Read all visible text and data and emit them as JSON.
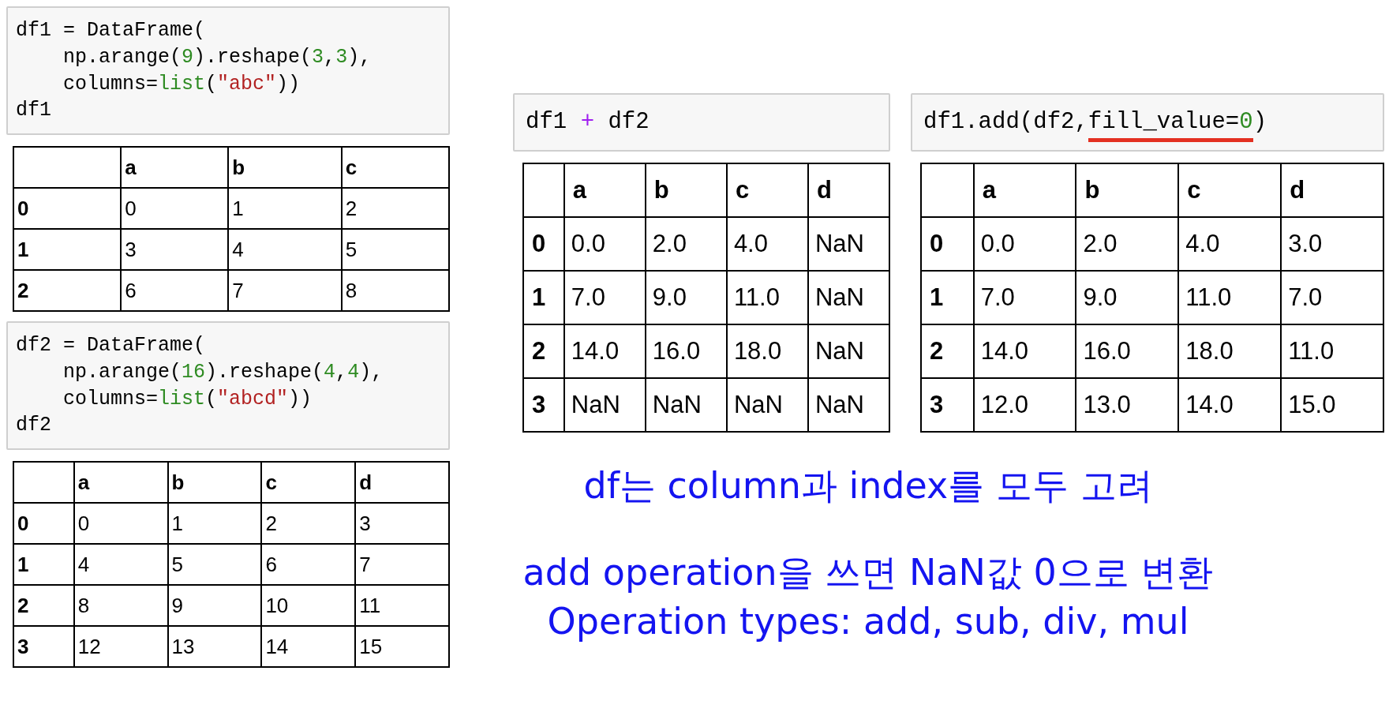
{
  "cells": [
    {
      "code": [
        [
          {
            "kind": "plain",
            "text": "df1 = DataFrame("
          }
        ],
        [
          {
            "kind": "plain",
            "text": "    np.arange("
          },
          {
            "kind": "number",
            "text": "9"
          },
          {
            "kind": "plain",
            "text": ").reshape("
          },
          {
            "kind": "number",
            "text": "3"
          },
          {
            "kind": "plain",
            "text": ","
          },
          {
            "kind": "number",
            "text": "3"
          },
          {
            "kind": "plain",
            "text": "),"
          }
        ],
        [
          {
            "kind": "plain",
            "text": "    columns="
          },
          {
            "kind": "builtin",
            "text": "list"
          },
          {
            "kind": "plain",
            "text": "("
          },
          {
            "kind": "string",
            "text": "\"abc\""
          },
          {
            "kind": "plain",
            "text": "))"
          }
        ],
        [
          {
            "kind": "plain",
            "text": "df1"
          }
        ]
      ],
      "table": {
        "columns": [
          "a",
          "b",
          "c"
        ],
        "rows": [
          {
            "index": "0",
            "values": [
              "0",
              "1",
              "2"
            ]
          },
          {
            "index": "1",
            "values": [
              "3",
              "4",
              "5"
            ]
          },
          {
            "index": "2",
            "values": [
              "6",
              "7",
              "8"
            ]
          }
        ]
      }
    },
    {
      "code": [
        [
          {
            "kind": "plain",
            "text": "df2 = DataFrame("
          }
        ],
        [
          {
            "kind": "plain",
            "text": "    np.arange("
          },
          {
            "kind": "number",
            "text": "16"
          },
          {
            "kind": "plain",
            "text": ").reshape("
          },
          {
            "kind": "number",
            "text": "4"
          },
          {
            "kind": "plain",
            "text": ","
          },
          {
            "kind": "number",
            "text": "4"
          },
          {
            "kind": "plain",
            "text": "),"
          }
        ],
        [
          {
            "kind": "plain",
            "text": "    columns="
          },
          {
            "kind": "builtin",
            "text": "list"
          },
          {
            "kind": "plain",
            "text": "("
          },
          {
            "kind": "string",
            "text": "\"abcd\""
          },
          {
            "kind": "plain",
            "text": "))"
          }
        ],
        [
          {
            "kind": "plain",
            "text": "df2"
          }
        ]
      ],
      "table": {
        "columns": [
          "a",
          "b",
          "c",
          "d"
        ],
        "rows": [
          {
            "index": "0",
            "values": [
              "0",
              "1",
              "2",
              "3"
            ]
          },
          {
            "index": "1",
            "values": [
              "4",
              "5",
              "6",
              "7"
            ]
          },
          {
            "index": "2",
            "values": [
              "8",
              "9",
              "10",
              "11"
            ]
          },
          {
            "index": "3",
            "values": [
              "12",
              "13",
              "14",
              "15"
            ]
          }
        ]
      }
    },
    {
      "code": [
        [
          {
            "kind": "plain",
            "text": "df1 "
          },
          {
            "kind": "operator",
            "text": "+"
          },
          {
            "kind": "plain",
            "text": " df2"
          }
        ]
      ],
      "table": {
        "columns": [
          "a",
          "b",
          "c",
          "d"
        ],
        "rows": [
          {
            "index": "0",
            "values": [
              "0.0",
              "2.0",
              "4.0",
              "NaN"
            ]
          },
          {
            "index": "1",
            "values": [
              "7.0",
              "9.0",
              "11.0",
              "NaN"
            ]
          },
          {
            "index": "2",
            "values": [
              "14.0",
              "16.0",
              "18.0",
              "NaN"
            ]
          },
          {
            "index": "3",
            "values": [
              "NaN",
              "NaN",
              "NaN",
              "NaN"
            ]
          }
        ]
      }
    },
    {
      "code": [
        [
          {
            "kind": "plain",
            "text": "df1.add(df2,"
          },
          {
            "kind": "plain",
            "text": "fill_value=",
            "underlined": true
          },
          {
            "kind": "number",
            "text": "0",
            "underlined": true
          },
          {
            "kind": "plain",
            "text": ")"
          }
        ]
      ],
      "table": {
        "columns": [
          "a",
          "b",
          "c",
          "d"
        ],
        "rows": [
          {
            "index": "0",
            "values": [
              "0.0",
              "2.0",
              "4.0",
              "3.0"
            ]
          },
          {
            "index": "1",
            "values": [
              "7.0",
              "9.0",
              "11.0",
              "7.0"
            ]
          },
          {
            "index": "2",
            "values": [
              "14.0",
              "16.0",
              "18.0",
              "11.0"
            ]
          },
          {
            "index": "3",
            "values": [
              "12.0",
              "13.0",
              "14.0",
              "15.0"
            ]
          }
        ]
      }
    }
  ],
  "notes": [
    "df는 column과 index를 모두 고려",
    "add operation을 쓰면 NaN값 0으로 변환",
    "Operation types: add, sub, div, mul"
  ]
}
